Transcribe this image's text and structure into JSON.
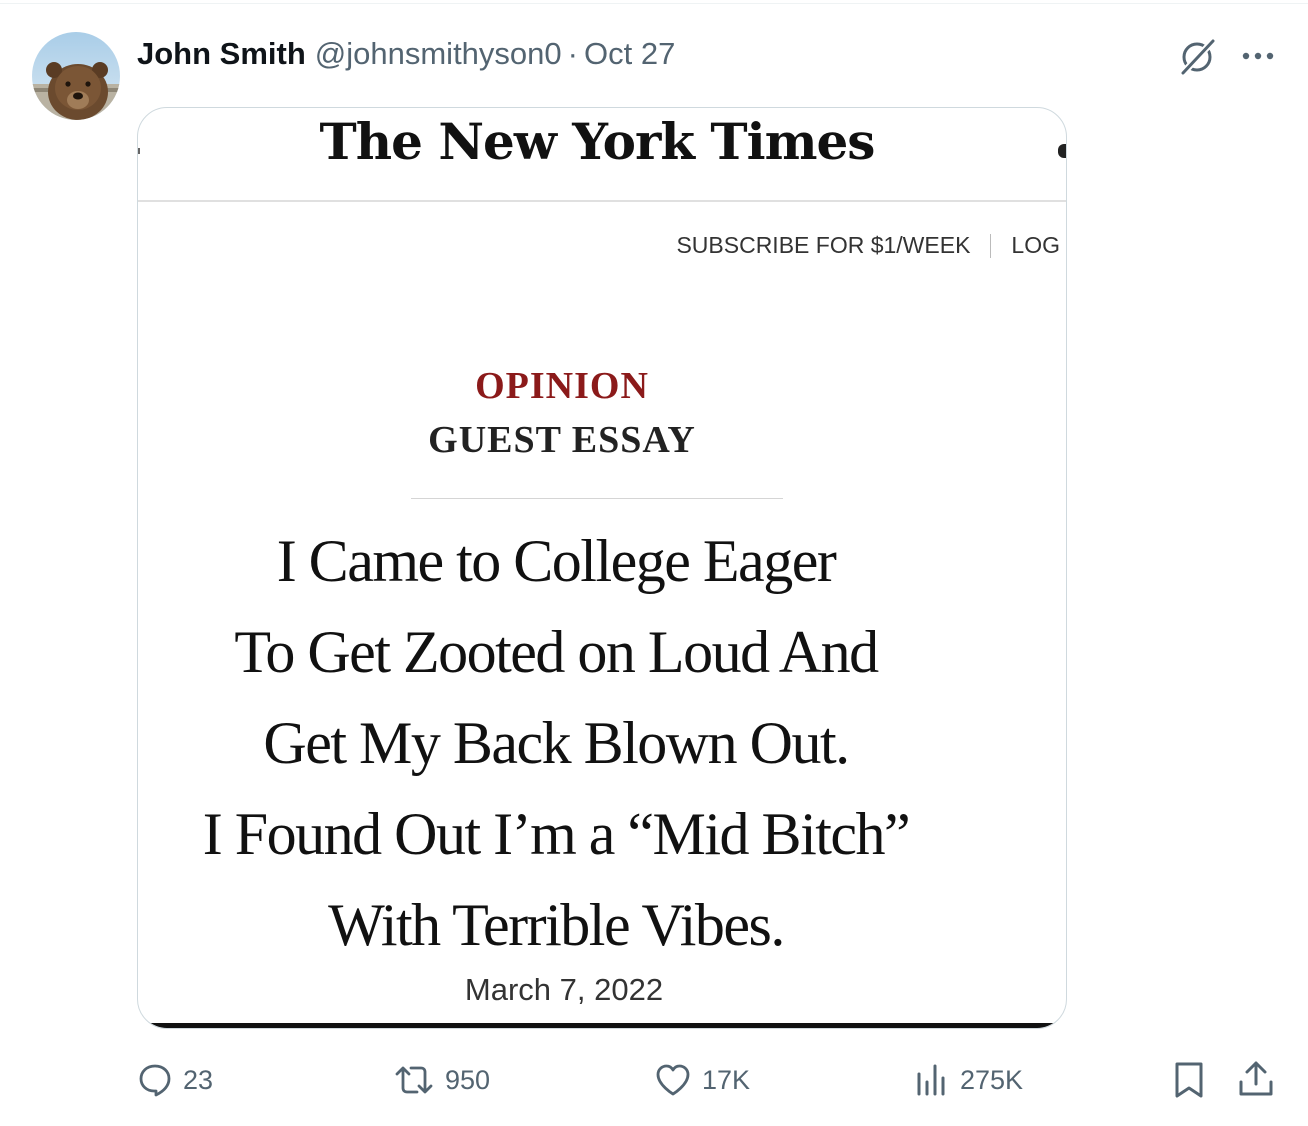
{
  "post": {
    "author": {
      "display_name": "John Smith",
      "handle": "@johnsmithyson0",
      "avatar_icon": "bear-avatar"
    },
    "separator": "·",
    "timestamp": "Oct 27",
    "menu_icons": [
      "grok-icon",
      "more-icon"
    ],
    "image": {
      "masthead": "The New York Times",
      "nav": {
        "subscribe": "SUBSCRIBE FOR $1/WEEK",
        "login": "LOG"
      },
      "kicker": "OPINION",
      "section": "GUEST ESSAY",
      "headline_lines": [
        "I Came to College Eager",
        "To Get Zooted on Loud And",
        "Get My Back Blown Out.",
        "I Found Out I’m a “Mid Bitch”",
        "With Terrible Vibes."
      ],
      "date": "March 7, 2022",
      "colors": {
        "kicker": "#8b1a1a"
      }
    },
    "actions": {
      "replies": "23",
      "reposts": "950",
      "likes": "17K",
      "views": "275K"
    }
  },
  "colors": {
    "text_primary": "#0f1419",
    "text_secondary": "#536471",
    "border": "#cfd9de"
  }
}
